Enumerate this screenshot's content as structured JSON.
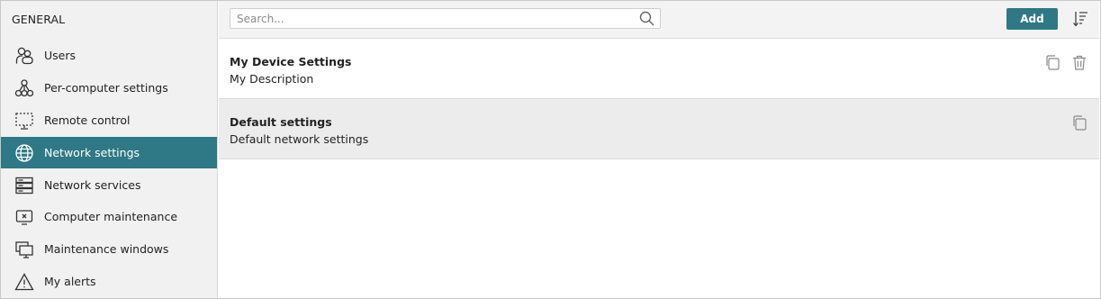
{
  "sidebar": {
    "heading": "GENERAL",
    "items": [
      {
        "label": "Users",
        "icon": "users-icon",
        "active": false
      },
      {
        "label": "Per-computer settings",
        "icon": "network-nodes-icon",
        "active": false
      },
      {
        "label": "Remote control",
        "icon": "remote-screen-icon",
        "active": false
      },
      {
        "label": "Network settings",
        "icon": "globe-icon",
        "active": true
      },
      {
        "label": "Network services",
        "icon": "server-stack-icon",
        "active": false
      },
      {
        "label": "Computer maintenance",
        "icon": "monitor-x-icon",
        "active": false
      },
      {
        "label": "Maintenance windows",
        "icon": "windows-stack-icon",
        "active": false
      },
      {
        "label": "My alerts",
        "icon": "warning-icon",
        "active": false
      }
    ]
  },
  "toolbar": {
    "search_placeholder": "Search...",
    "search_value": "",
    "add_label": "Add",
    "sort_icon": "sort-icon"
  },
  "list": {
    "items": [
      {
        "title": "My Device Settings",
        "description": "My Description",
        "actions": [
          "copy-icon",
          "trash-icon"
        ]
      },
      {
        "title": "Default settings",
        "description": "Default network settings",
        "actions": [
          "copy-icon"
        ]
      }
    ]
  },
  "colors": {
    "accent": "#2f7885",
    "sidebar_bg": "#f1f1f1",
    "toolbar_bg": "#f3f3f3",
    "selected_row_bg": "#ececec"
  }
}
